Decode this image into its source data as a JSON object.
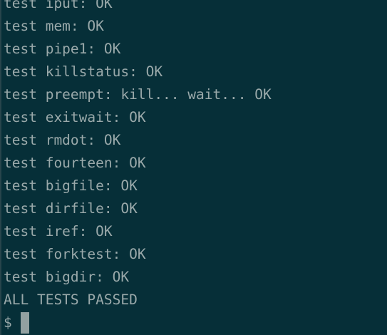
{
  "terminal": {
    "lines": [
      "test iput: OK",
      "test mem: OK",
      "test pipe1: OK",
      "test killstatus: OK",
      "test preempt: kill... wait... OK",
      "test exitwait: OK",
      "test rmdot: OK",
      "test fourteen: OK",
      "test bigfile: OK",
      "test dirfile: OK",
      "test iref: OK",
      "test forktest: OK",
      "test bigdir: OK",
      "ALL TESTS PASSED"
    ],
    "prompt": "$"
  }
}
